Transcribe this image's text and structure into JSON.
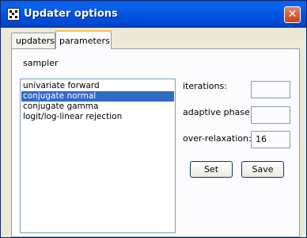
{
  "window": {
    "title": "Updater options",
    "close_icon": "close-icon",
    "app_icon": "grid-app-icon"
  },
  "tabs": [
    {
      "label": "updaters",
      "selected": false
    },
    {
      "label": "parameters",
      "selected": true
    }
  ],
  "panel": {
    "section_label": "sampler",
    "sampler_list": [
      {
        "label": "univariate forward",
        "selected": false
      },
      {
        "label": "conjugate normal",
        "selected": true
      },
      {
        "label": "conjugate gamma",
        "selected": false
      },
      {
        "label": "logit/log-linear rejection",
        "selected": false
      }
    ],
    "fields": {
      "iterations": {
        "label": "iterations:",
        "value": ""
      },
      "adaptive_phase": {
        "label": "adaptive phase:",
        "value": ""
      },
      "over_relaxation": {
        "label": "over-relaxation:",
        "value": "16"
      }
    },
    "buttons": {
      "set": "Set",
      "save": "Save"
    }
  },
  "colors": {
    "title_bar": "#0053e0",
    "selection": "#316ac5",
    "window_face": "#ece9d8"
  }
}
